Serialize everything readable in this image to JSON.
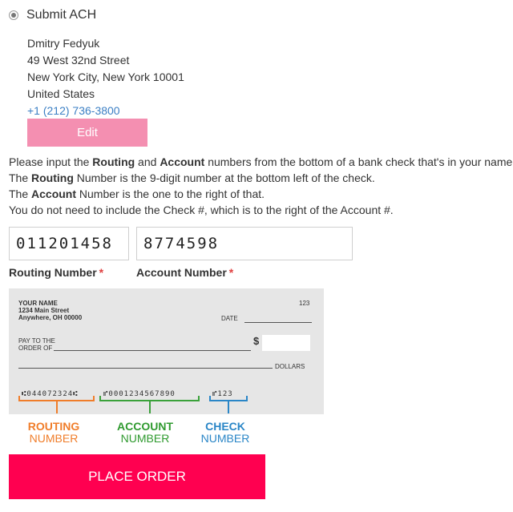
{
  "payment_option": {
    "label": "Submit ACH",
    "selected": true
  },
  "address": {
    "name": "Dmitry Fedyuk",
    "street": "49 West 32nd Street",
    "city_state_zip": "New York City, New York 10001",
    "country": "United States",
    "phone": "+1 (212) 736-3800"
  },
  "edit_label": "Edit",
  "instructions": {
    "line1_a": "Please input the ",
    "line1_routing": "Routing",
    "line1_and": " and ",
    "line1_account": "Account",
    "line1_b": " numbers from the bottom of a bank check that's in your name.",
    "line2_a": "The ",
    "line2_routing": "Routing",
    "line2_b": " Number is the 9-digit number at the bottom left of the check.",
    "line3_a": "The ",
    "line3_account": "Account",
    "line3_b": " Number is the one to the right of that.",
    "line4": "You do not need to include the Check #, which is to the right of the Account #."
  },
  "fields": {
    "routing_value": "011201458",
    "account_value": "8774598",
    "routing_label": "Routing Number",
    "account_label": "Account Number",
    "required_mark": "*"
  },
  "check": {
    "name": "YOUR NAME",
    "street": "1234 Main Street",
    "city": "Anywhere, OH 00000",
    "number": "123",
    "date_label": "DATE",
    "pay_to_1": "PAY TO THE",
    "pay_to_2": "ORDER OF",
    "dollar_sign": "$",
    "dollars_label": "DOLLARS",
    "micr_routing": "⑆044072324⑆",
    "micr_account": "⑈0001234567890",
    "micr_check": "⑈123"
  },
  "legend": {
    "routing_1": "ROUTING",
    "routing_2": "NUMBER",
    "account_1": "ACCOUNT",
    "account_2": "NUMBER",
    "check_1": "CHECK",
    "check_2": "NUMBER"
  },
  "place_order_label": "PLACE ORDER",
  "colors": {
    "edit_button": "#f48fb1",
    "place_order_button": "#ff0050",
    "link": "#3b7fc4",
    "routing": "#f07d2a",
    "account": "#3aa13a",
    "check": "#2a86c7"
  }
}
